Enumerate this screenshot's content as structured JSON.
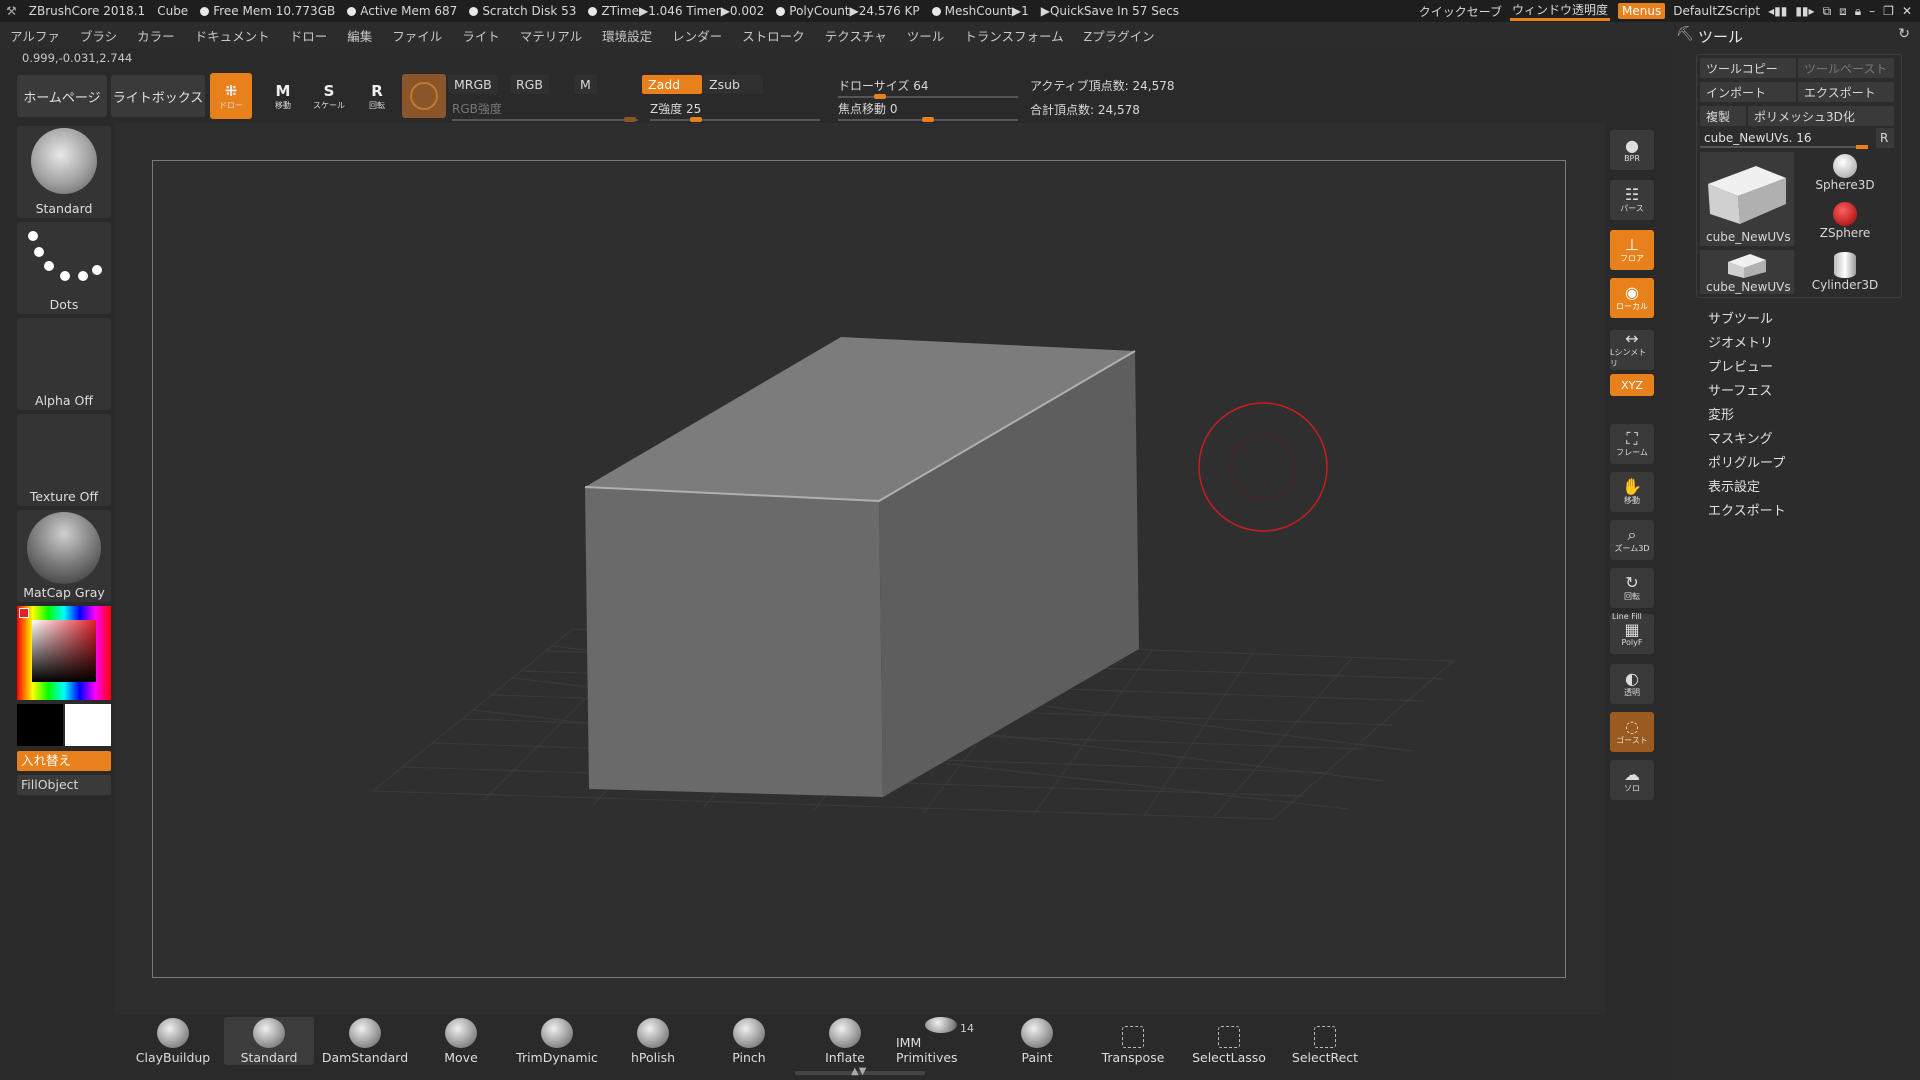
{
  "titlebar": {
    "app": "ZBrushCore 2018.1",
    "doc": "Cube",
    "stats": [
      "Free Mem 10.773GB",
      "Active Mem 687",
      "Scratch Disk 53",
      "ZTime▶1.046 Timer▶0.002",
      "PolyCount▶24.576 KP",
      "MeshCount▶1"
    ],
    "quicksave": "▶QuickSave In 57 Secs",
    "quick_save_btn": "クイックセーブ",
    "window_transparency": "ウィンドウ透明度",
    "menus": "Menus",
    "script": "DefaultZScript"
  },
  "menubar": [
    "アルファ",
    "ブラシ",
    "カラー",
    "ドキュメント",
    "ドロー",
    "編集",
    "ファイル",
    "ライト",
    "マテリアル",
    "環境設定",
    "レンダー",
    "ストローク",
    "テクスチャ",
    "ツール",
    "トランスフォーム",
    "Zプラグイン"
  ],
  "coords": "0.999,-0.031,2.744",
  "toolbar": {
    "home": "ホームページ",
    "lightbox": "ライトボックス",
    "draw": "ドロー",
    "move": "移動",
    "scale": "スケール",
    "rotate": "回転",
    "mrgb": "MRGB",
    "rgb": "RGB",
    "m": "M",
    "zadd": "Zadd",
    "zsub": "Zsub",
    "rgb_intensity": "RGB強度",
    "z_intensity_label": "Z強度 25",
    "z_intensity_value": 25,
    "draw_size_label": "ドローサイズ 64",
    "draw_size_value": 64,
    "focal_shift_label": "焦点移動 0",
    "focal_shift_value": 0,
    "active_points": "アクティブ頂点数: 24,578",
    "total_points": "合計頂点数: 24,578"
  },
  "left_shelf": {
    "brush": "Standard",
    "stroke": "Dots",
    "alpha": "Alpha Off",
    "texture": "Texture Off",
    "material": "MatCap Gray",
    "swap": "入れ替え",
    "fill": "FillObject"
  },
  "right_rail": [
    {
      "name": "bpr",
      "label": "BPR",
      "state": "normal"
    },
    {
      "name": "perspective",
      "label": "パース",
      "state": "normal"
    },
    {
      "name": "floor",
      "label": "フロア",
      "state": "on"
    },
    {
      "name": "local",
      "label": "ローカル",
      "state": "on"
    },
    {
      "name": "symmetry",
      "label": "Lシンメトリ",
      "state": "normal"
    },
    {
      "name": "xyz",
      "label": "XYZ",
      "state": "on"
    },
    {
      "name": "frame",
      "label": "フレーム",
      "state": "normal"
    },
    {
      "name": "move",
      "label": "移動",
      "state": "normal"
    },
    {
      "name": "zoom3d",
      "label": "ズーム3D",
      "state": "normal"
    },
    {
      "name": "rotate",
      "label": "回転",
      "state": "normal"
    },
    {
      "name": "linefill",
      "label": "PolyF",
      "state": "normal"
    },
    {
      "name": "transp",
      "label": "透明",
      "state": "normal"
    },
    {
      "name": "ghost",
      "label": "ゴースト",
      "state": "dim"
    },
    {
      "name": "solo",
      "label": "ソロ",
      "state": "normal"
    }
  ],
  "linefill_top": "Line Fill",
  "toolpanel": {
    "title": "ツール",
    "tool_copy": "ツールコピー",
    "tool_paste": "ツールペースト",
    "import": "インポート",
    "export": "エクスポート",
    "clone": "複製",
    "polymesh": "ポリメッシュ3D化",
    "current_tool": "cube_NewUVs. 16",
    "current_tool_value": 16,
    "r": "R",
    "thumbs": [
      "cube_NewUVs",
      "Sphere3D",
      "ZSphere",
      "cube_NewUVs",
      "Cylinder3D"
    ],
    "sections": [
      "サブツール",
      "ジオメトリ",
      "プレビュー",
      "サーフェス",
      "変形",
      "マスキング",
      "ポリグループ",
      "表示設定",
      "エクスポート"
    ]
  },
  "bottom_shelf": [
    {
      "label": "ClayBuildup",
      "selected": false
    },
    {
      "label": "Standard",
      "selected": true
    },
    {
      "label": "DamStandard",
      "selected": false
    },
    {
      "label": "Move",
      "selected": false
    },
    {
      "label": "TrimDynamic",
      "selected": false
    },
    {
      "label": "hPolish",
      "selected": false
    },
    {
      "label": "Pinch",
      "selected": false
    },
    {
      "label": "Inflate",
      "selected": false
    },
    {
      "label": "IMM Primitives",
      "selected": false
    },
    {
      "label": "Paint",
      "selected": false
    },
    {
      "label": "Transpose",
      "selected": false
    },
    {
      "label": "SelectLasso",
      "selected": false
    },
    {
      "label": "SelectRect",
      "selected": false
    }
  ],
  "imm_count": "14",
  "colors": {
    "accent": "#e8801c",
    "cursor": "#c81e1e"
  }
}
